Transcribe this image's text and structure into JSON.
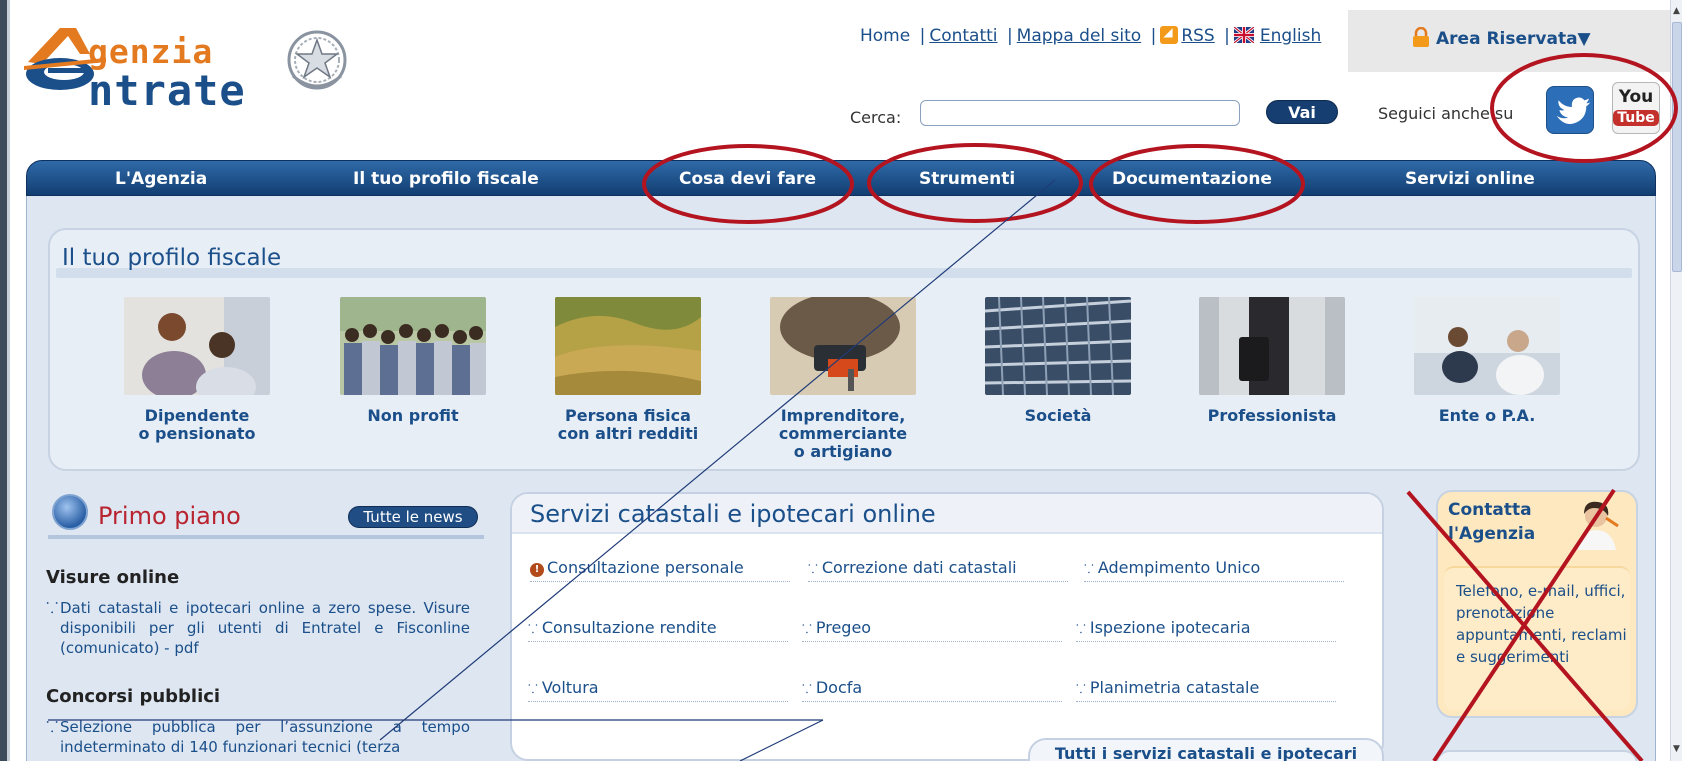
{
  "header": {
    "logo_line1": "genzia",
    "logo_line2": "ntrate",
    "top_links": {
      "home": "Home",
      "contatti": "Contatti",
      "mappa": "Mappa del sito",
      "rss": "RSS",
      "english": "English"
    },
    "area_riservata": "Area Riservata▼",
    "search_label": "Cerca:",
    "search_value": "",
    "search_button": "Vai",
    "follow_label": "Seguici anche su",
    "youtube_top": "You",
    "youtube_bottom": "Tube"
  },
  "nav": {
    "items": [
      "L'Agenzia",
      "Il tuo profilo fiscale",
      "Cosa devi fare",
      "Strumenti",
      "Documentazione",
      "Servizi online"
    ]
  },
  "profile": {
    "title": "Il tuo profilo fiscale",
    "items": [
      {
        "line1": "Dipendente",
        "line2": "o pensionato",
        "line3": ""
      },
      {
        "line1": "Non profit",
        "line2": "",
        "line3": ""
      },
      {
        "line1": "Persona fisica",
        "line2": "con altri redditi",
        "line3": ""
      },
      {
        "line1": "Imprenditore,",
        "line2": "commerciante",
        "line3": "o artigiano"
      },
      {
        "line1": "Società",
        "line2": "",
        "line3": ""
      },
      {
        "line1": "Professionista",
        "line2": "",
        "line3": ""
      },
      {
        "line1": "Ente o P.A.",
        "line2": "",
        "line3": ""
      }
    ]
  },
  "primo_piano": {
    "title": "Primo piano",
    "news_button": "Tutte le news",
    "items": [
      {
        "heading": "Visure online",
        "text": "Dati catastali e ipotecari online a zero spese. Visure disponibili per gli utenti di Entratel e Fisconline (comunicato) - pdf"
      },
      {
        "heading": "Concorsi pubblici",
        "text": "Selezione pubblica per l’assunzione a tempo indeterminato di 140 funzionari tecnici (terza"
      }
    ]
  },
  "catastali": {
    "title": "Servizi catastali e ipotecari online",
    "links": [
      "Consultazione personale",
      "Correzione dati catastali",
      "Adempimento Unico",
      "Consultazione rendite",
      "Pregeo",
      "Ispezione ipotecaria",
      "Voltura",
      "Docfa",
      "Planimetria catastale"
    ],
    "all_button": "Tutti i servizi catastali e ipotecari"
  },
  "contact": {
    "title_line1": "Contatta",
    "title_line2": "l'Agenzia",
    "text": "Telefono, e-mail, uffici, prenotazione appuntamenti, reclami e suggerimenti"
  },
  "colors": {
    "brand_blue": "#1b4f8a",
    "brand_orange": "#e47a1f",
    "annotation_red": "#b3141f"
  }
}
